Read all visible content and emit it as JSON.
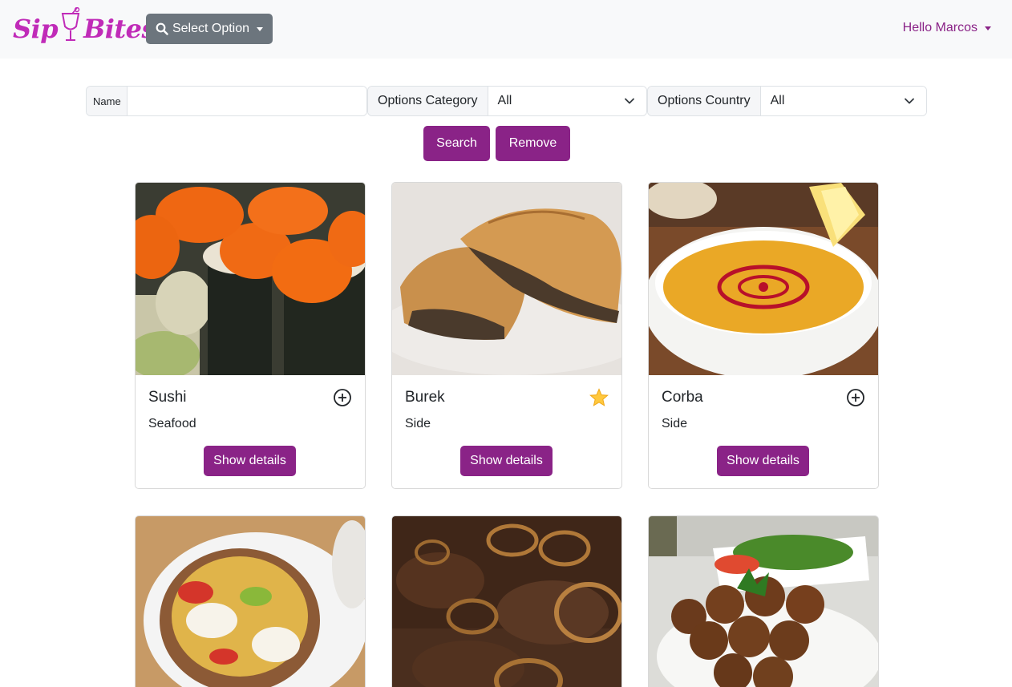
{
  "brand": {
    "left": "Sip",
    "right": "Bites"
  },
  "nav": {
    "select_label": "Select Option",
    "user_label": "Hello Marcos"
  },
  "filters": {
    "name_label": "Name",
    "name_value": "",
    "category_label": "Options Category",
    "category_value": "All",
    "country_label": "Options Country",
    "country_value": "All"
  },
  "actions": {
    "search_label": "Search",
    "remove_label": "Remove"
  },
  "cards": [
    {
      "title": "Sushi",
      "category": "Seafood",
      "favorite": false,
      "details_label": "Show details"
    },
    {
      "title": "Burek",
      "category": "Side",
      "favorite": true,
      "details_label": "Show details"
    },
    {
      "title": "Corba",
      "category": "Side",
      "favorite": false,
      "details_label": "Show details"
    },
    {
      "title": "",
      "category": "",
      "favorite": false,
      "details_label": ""
    },
    {
      "title": "",
      "category": "",
      "favorite": false,
      "details_label": ""
    },
    {
      "title": "",
      "category": "",
      "favorite": false,
      "details_label": ""
    }
  ],
  "colors": {
    "brand": "#c02bb8",
    "primary": "#8a2387",
    "secondary": "#6c757d",
    "favorite": "#ffc83d"
  }
}
